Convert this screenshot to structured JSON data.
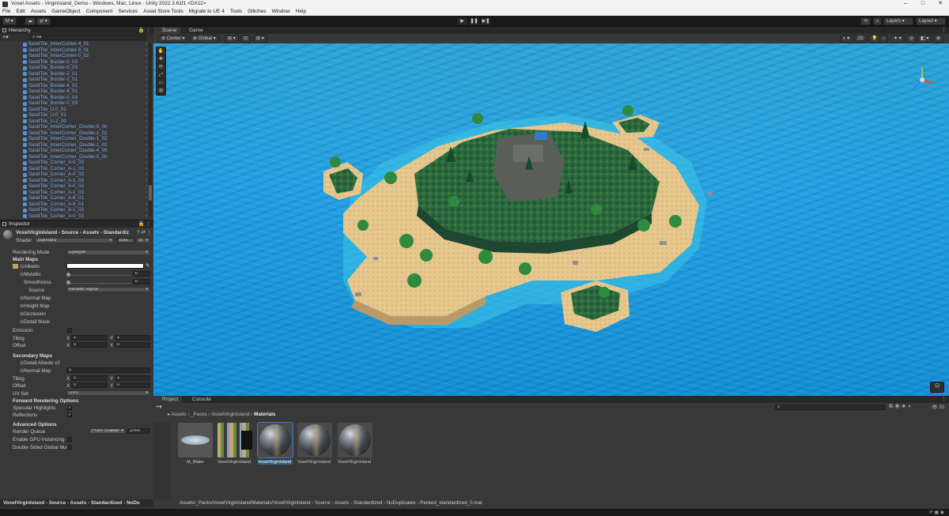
{
  "window": {
    "title": "Voxel Assets - VirginIsland_Demo - Windows, Mac, Linux - Unity 2022.3.61f1 <DX11>",
    "controls": [
      "–",
      "□",
      "✕"
    ]
  },
  "menu": [
    "File",
    "Edit",
    "Assets",
    "GameObject",
    "Component",
    "Services",
    "Asset Store Tools",
    "Migrate to UE 4",
    "Tools",
    "Glitches",
    "Window",
    "Help"
  ],
  "toolbar": {
    "account": "M",
    "layers": "Layers",
    "layout": "Layout"
  },
  "hierarchy": {
    "title": "Hierarchy",
    "search": "All",
    "items": [
      "SandTile_InnerCorner-4_01",
      "SandTile_InnerCorner-4_01",
      "SandTile_InnerCorner-0_02",
      "SandTile_Border-0_03",
      "SandTile_Border-0_03",
      "SandTile_Border-2_01",
      "SandTile_Border-2_01",
      "SandTile_Border-4_01",
      "SandTile_Border-4_01",
      "SandTile_Border-0_03",
      "SandTile_Border-0_03",
      "SandTile_U-0_01",
      "SandTile_U-0_01",
      "SandTile_U-2_00",
      "SandTile_InnerCorner_Double-0_00",
      "SandTile_InnerCorner_Double-1_02",
      "SandTile_InnerCorner_Double-1_02",
      "SandTile_InnerCorner_Double-1_02",
      "SandTile_InnerCorner_Double-4_00",
      "SandTile_InnerCorner_Double-5_00",
      "SandTile_Corner_A-0_03",
      "SandTile_Corner_A-1_03",
      "SandTile_Corner_A-0_03",
      "SandTile_Corner_A-1_03",
      "SandTile_Corner_A-0_03",
      "SandTile_Corner_A-1_03",
      "SandTile_Corner_A-8_01",
      "SandTile_Corner_A-8_01",
      "SandTile_Corner_A-1_03",
      "SandTile_Corner_A-0_03"
    ]
  },
  "inspector": {
    "title": "Inspector",
    "material_name": "VoxelVirginIsland - Source - Assets - Standardiz",
    "shader_label": "Shader",
    "shader_value": "Standard",
    "edit_button": "Edit...",
    "rendering_mode_label": "Rendering Mode",
    "rendering_mode_value": "Opaque",
    "main_maps": "Main Maps",
    "albedo": "Albedo",
    "metallic": "Metallic",
    "metallic_value": "0",
    "smoothness": "Smoothness",
    "smoothness_value": "0",
    "source": "Source",
    "source_value": "Metallic Alpha",
    "normal_map": "Normal Map",
    "height_map": "Height Map",
    "occlusion": "Occlusion",
    "detail_mask": "Detail Mask",
    "emission": "Emission",
    "tiling": "Tiling",
    "offset": "Offset",
    "x": "X",
    "y": "Y",
    "tiling_x": "1",
    "tiling_y": "1",
    "offset_x": "0",
    "offset_y": "0",
    "secondary_maps": "Secondary Maps",
    "detail_albedo": "Detail Albedo x2",
    "sec_normal_map": "Normal Map",
    "sec_normal_value": "1",
    "sec_tiling_x": "1",
    "sec_tiling_y": "1",
    "sec_offset_x": "0",
    "sec_offset_y": "0",
    "uv_set": "UV Set",
    "uv_set_value": "UV0",
    "forward_options": "Forward Rendering Options",
    "specular_highlights": "Specular Highlights",
    "reflections": "Reflections",
    "advanced_options": "Advanced Options",
    "render_queue": "Render Queue",
    "render_queue_mode": "From Shader",
    "render_queue_value": "2000",
    "gpu_instancing": "Enable GPU Instancing",
    "double_sided_gi": "Double Sided Global Illur",
    "footer": "VoxelVirginIsland - Source - Assets - Standardized - NoDu"
  },
  "scene": {
    "tabs": [
      "Scene",
      "Game"
    ],
    "pivot": "Center",
    "space": "Global",
    "mode_2d": "2D",
    "gizmo_tools": [
      "✋",
      "✥",
      "⟳",
      "⤢",
      "▭",
      "⊞"
    ]
  },
  "project": {
    "tabs": [
      "Project",
      "Console"
    ],
    "breadcrumb": [
      "Assets",
      "_Packs",
      "VoxelVirginIsland",
      "Materials"
    ],
    "assets": [
      {
        "name": "M_Water",
        "kind": "water"
      },
      {
        "name": "VoxelVirginIsland ...",
        "kind": "texture"
      },
      {
        "name": "VoxelVirginIsland ...",
        "kind": "sphere",
        "selected": true
      },
      {
        "name": "VoxelVirginIsland ...",
        "kind": "sphere"
      },
      {
        "name": "VoxelVirginIsland ...",
        "kind": "sphere"
      }
    ],
    "count": "30",
    "footer": "Assets/_Packs/VoxelVirginIsland/Materials/VoxelVirginIsland - Source - Assets - Standardized - NoDuplicates - Packed_standardized_0.mat"
  },
  "colors": {
    "accent": "#2c5d87",
    "link": "#7fa8e8",
    "water": "#1e9fe0",
    "sand": "#e8c98f",
    "grass": "#2f6b3a"
  }
}
